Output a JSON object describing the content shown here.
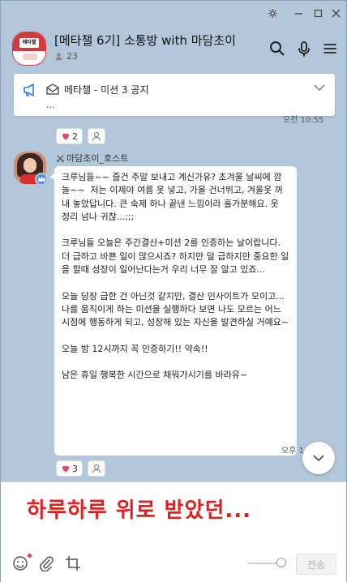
{
  "window": {
    "controls": [
      "⚙",
      "—",
      "☐",
      "✕"
    ]
  },
  "room": {
    "title": "[메타챌 6기] 소통방 with 마담초이",
    "avatar_label": "메타챌",
    "member_count": "23"
  },
  "notice": {
    "title": "메타챌 - 미션 3 공지",
    "preview": "..."
  },
  "previous": {
    "time_partial": "오전 10:55",
    "reactions": [
      {
        "icon": "heart-icon",
        "count": "2"
      },
      {
        "icon": "person-icon",
        "count": ""
      }
    ]
  },
  "message": {
    "sender": "마담초이_호스트",
    "sender_prefix_icon": "crossed-swords-icon",
    "text": "크루님들~~ 즐건 주말 보내고 계신가유? 초겨울 날씨에 깜놀~~  저는 이제야 여름 옷 넣고, 가을 건너뛰고, 겨울옷 꺼내 놓았답니다. 큰 숙제 하나 끝낸 느낌이라 홀가분해요. 옷 정리 넘나 귀찮...;;;\n\n크루님들 오늘은 주간결산+미션 2를 인증하는 날이랍니다. 더 급하고 바쁜 일이 많으시죠? 하지만 덜 급하지만 중요한 일을 할때 성장이 일어난다는거 우리 너무 잘 알고 있죠...\n\n오늘 당장 급한 건 아닌것 같지만, 결산 인사이트가 모이고... 나를 움직이게 하는 미션을 실행하다 보면 나도 모르는 어느 시점에 행동하게 되고, 성장해 있는 자신을 발견하실 거예요~\n\n오늘 밤 12시까지 꼭 인증하기!! 약속!!\n\n남은 휴일 행복한 시간으로 채워가시기를 바라유~",
    "time": "오후 1:",
    "reactions": [
      {
        "icon": "heart-icon",
        "count": "3"
      },
      {
        "icon": "person-icon",
        "count": ""
      }
    ]
  },
  "input": {
    "text": "하루하루 위로 받았던...",
    "send_label": "전송"
  },
  "colors": {
    "background": "#b2c7d9",
    "heart": "#e8435a",
    "input_text": "#e02020",
    "badge": "#4f8fe0"
  }
}
